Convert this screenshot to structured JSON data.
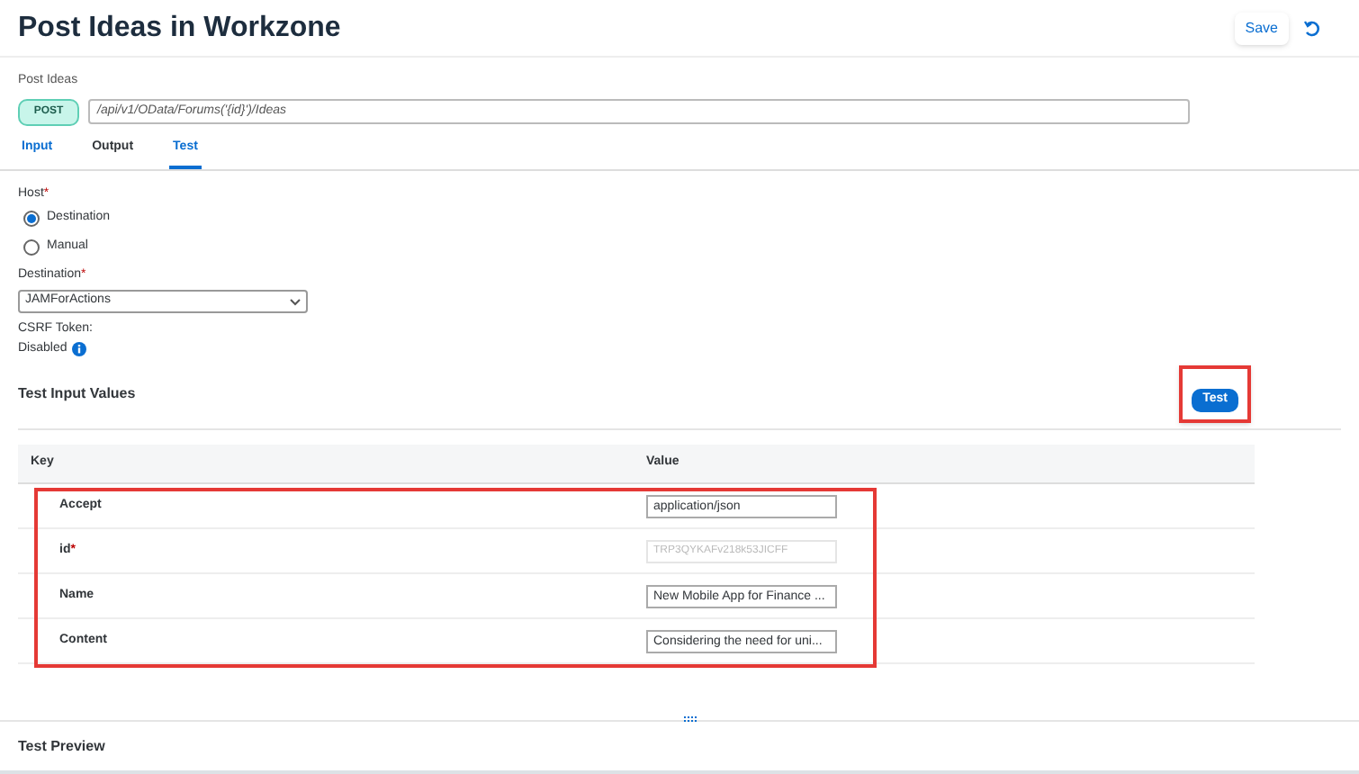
{
  "title": "Post Ideas in Workzone",
  "header_buttons": {
    "save": "Save"
  },
  "endpoint": {
    "label": "Post Ideas",
    "method": "POST",
    "path": "/api/v1/OData/Forums('{id}')/Ideas"
  },
  "tabs": [
    {
      "label": "Input",
      "selected": false
    },
    {
      "label": "Output",
      "selected": false
    },
    {
      "label": "Test",
      "selected": true
    }
  ],
  "host": {
    "label": "Host",
    "required_mark": "*",
    "options": [
      {
        "label": "Destination",
        "selected": true
      },
      {
        "label": "Manual",
        "selected": false
      }
    ]
  },
  "destination": {
    "label": "Destination",
    "required_mark": "*",
    "value": "JAMForActions"
  },
  "csrf": {
    "label": "CSRF Token:",
    "value": "Disabled"
  },
  "test_input": {
    "title": "Test Input Values",
    "button": "Test",
    "button_highlighted": true,
    "columns": [
      "Key",
      "Value"
    ],
    "rows": [
      {
        "key": "Accept",
        "value": "application/json",
        "disabled": false
      },
      {
        "key": "id",
        "required_mark": "*",
        "placeholder": "TRP3QYKAFv218k53JICFF",
        "disabled": true
      },
      {
        "key": "Name",
        "value": "New Mobile App for Finance ...",
        "disabled": false
      },
      {
        "key": "Content",
        "value": "Considering the need for uni...",
        "disabled": false
      }
    ],
    "rows_highlighted": true
  },
  "preview": {
    "title": "Test Preview"
  }
}
